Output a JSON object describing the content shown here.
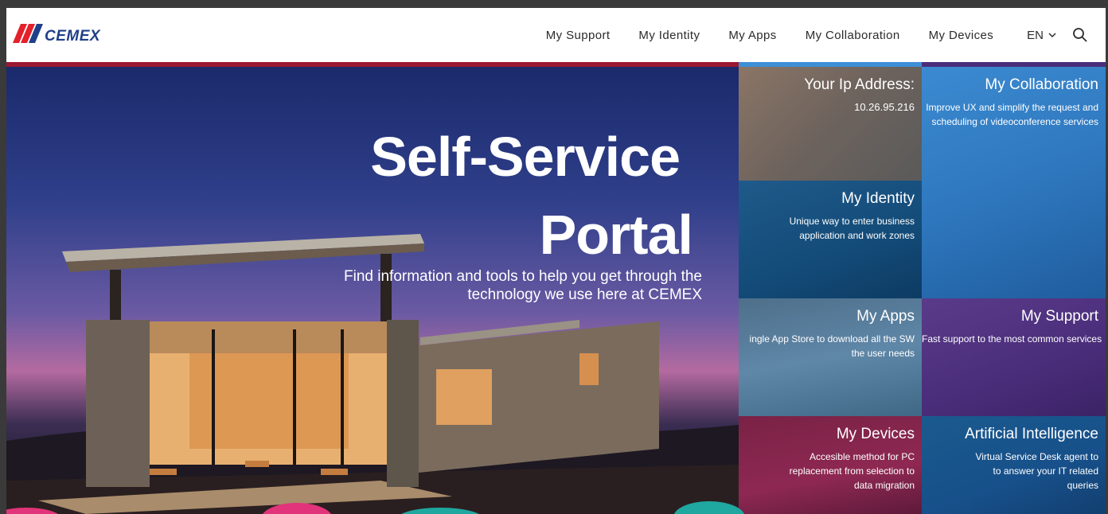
{
  "header": {
    "logo_text": "CEMEX",
    "nav": [
      "My Support",
      "My Identity",
      "My Apps",
      "My Collaboration",
      "My Devices"
    ],
    "language": "EN"
  },
  "hero": {
    "title_line1": "Self-Service",
    "title_line2": "Portal",
    "subtitle": "Find information and tools to help you get through the technology we use here at CEMEX"
  },
  "tiles": {
    "ip": {
      "title": "Your Ip Address:",
      "value": "10.26.95.216"
    },
    "collaboration": {
      "title": "My Collaboration",
      "desc": "Improve UX and simplify the request and scheduling of videoconference services"
    },
    "identity": {
      "title": "My Identity",
      "desc": "Unique way to enter business application and work zones"
    },
    "apps": {
      "title": "My Apps",
      "desc": "ingle App Store to download all the SW the user needs"
    },
    "support": {
      "title": "My Support",
      "desc": "Fast support to the most common services"
    },
    "devices": {
      "title": "My Devices",
      "desc": "Accesible method for PC replacement from selection to data migration"
    },
    "ai": {
      "title": "Artificial Intelligence",
      "desc": "Virtual Service Desk agent to to answer your IT related queries"
    }
  },
  "colors": {
    "brand_blue": "#1f3f8a",
    "brand_red": "#e4202a",
    "accent_red": "#9b1832"
  }
}
